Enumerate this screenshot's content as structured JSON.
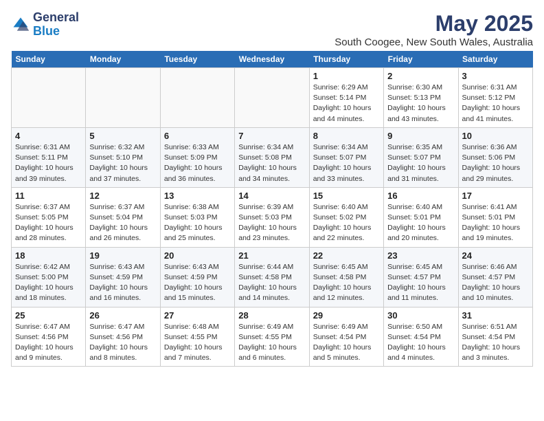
{
  "header": {
    "logo_general": "General",
    "logo_blue": "Blue",
    "month": "May 2025",
    "location": "South Coogee, New South Wales, Australia"
  },
  "weekdays": [
    "Sunday",
    "Monday",
    "Tuesday",
    "Wednesday",
    "Thursday",
    "Friday",
    "Saturday"
  ],
  "weeks": [
    [
      {
        "day": "",
        "text": ""
      },
      {
        "day": "",
        "text": ""
      },
      {
        "day": "",
        "text": ""
      },
      {
        "day": "",
        "text": ""
      },
      {
        "day": "1",
        "text": "Sunrise: 6:29 AM\nSunset: 5:14 PM\nDaylight: 10 hours\nand 44 minutes."
      },
      {
        "day": "2",
        "text": "Sunrise: 6:30 AM\nSunset: 5:13 PM\nDaylight: 10 hours\nand 43 minutes."
      },
      {
        "day": "3",
        "text": "Sunrise: 6:31 AM\nSunset: 5:12 PM\nDaylight: 10 hours\nand 41 minutes."
      }
    ],
    [
      {
        "day": "4",
        "text": "Sunrise: 6:31 AM\nSunset: 5:11 PM\nDaylight: 10 hours\nand 39 minutes."
      },
      {
        "day": "5",
        "text": "Sunrise: 6:32 AM\nSunset: 5:10 PM\nDaylight: 10 hours\nand 37 minutes."
      },
      {
        "day": "6",
        "text": "Sunrise: 6:33 AM\nSunset: 5:09 PM\nDaylight: 10 hours\nand 36 minutes."
      },
      {
        "day": "7",
        "text": "Sunrise: 6:34 AM\nSunset: 5:08 PM\nDaylight: 10 hours\nand 34 minutes."
      },
      {
        "day": "8",
        "text": "Sunrise: 6:34 AM\nSunset: 5:07 PM\nDaylight: 10 hours\nand 33 minutes."
      },
      {
        "day": "9",
        "text": "Sunrise: 6:35 AM\nSunset: 5:07 PM\nDaylight: 10 hours\nand 31 minutes."
      },
      {
        "day": "10",
        "text": "Sunrise: 6:36 AM\nSunset: 5:06 PM\nDaylight: 10 hours\nand 29 minutes."
      }
    ],
    [
      {
        "day": "11",
        "text": "Sunrise: 6:37 AM\nSunset: 5:05 PM\nDaylight: 10 hours\nand 28 minutes."
      },
      {
        "day": "12",
        "text": "Sunrise: 6:37 AM\nSunset: 5:04 PM\nDaylight: 10 hours\nand 26 minutes."
      },
      {
        "day": "13",
        "text": "Sunrise: 6:38 AM\nSunset: 5:03 PM\nDaylight: 10 hours\nand 25 minutes."
      },
      {
        "day": "14",
        "text": "Sunrise: 6:39 AM\nSunset: 5:03 PM\nDaylight: 10 hours\nand 23 minutes."
      },
      {
        "day": "15",
        "text": "Sunrise: 6:40 AM\nSunset: 5:02 PM\nDaylight: 10 hours\nand 22 minutes."
      },
      {
        "day": "16",
        "text": "Sunrise: 6:40 AM\nSunset: 5:01 PM\nDaylight: 10 hours\nand 20 minutes."
      },
      {
        "day": "17",
        "text": "Sunrise: 6:41 AM\nSunset: 5:01 PM\nDaylight: 10 hours\nand 19 minutes."
      }
    ],
    [
      {
        "day": "18",
        "text": "Sunrise: 6:42 AM\nSunset: 5:00 PM\nDaylight: 10 hours\nand 18 minutes."
      },
      {
        "day": "19",
        "text": "Sunrise: 6:43 AM\nSunset: 4:59 PM\nDaylight: 10 hours\nand 16 minutes."
      },
      {
        "day": "20",
        "text": "Sunrise: 6:43 AM\nSunset: 4:59 PM\nDaylight: 10 hours\nand 15 minutes."
      },
      {
        "day": "21",
        "text": "Sunrise: 6:44 AM\nSunset: 4:58 PM\nDaylight: 10 hours\nand 14 minutes."
      },
      {
        "day": "22",
        "text": "Sunrise: 6:45 AM\nSunset: 4:58 PM\nDaylight: 10 hours\nand 12 minutes."
      },
      {
        "day": "23",
        "text": "Sunrise: 6:45 AM\nSunset: 4:57 PM\nDaylight: 10 hours\nand 11 minutes."
      },
      {
        "day": "24",
        "text": "Sunrise: 6:46 AM\nSunset: 4:57 PM\nDaylight: 10 hours\nand 10 minutes."
      }
    ],
    [
      {
        "day": "25",
        "text": "Sunrise: 6:47 AM\nSunset: 4:56 PM\nDaylight: 10 hours\nand 9 minutes."
      },
      {
        "day": "26",
        "text": "Sunrise: 6:47 AM\nSunset: 4:56 PM\nDaylight: 10 hours\nand 8 minutes."
      },
      {
        "day": "27",
        "text": "Sunrise: 6:48 AM\nSunset: 4:55 PM\nDaylight: 10 hours\nand 7 minutes."
      },
      {
        "day": "28",
        "text": "Sunrise: 6:49 AM\nSunset: 4:55 PM\nDaylight: 10 hours\nand 6 minutes."
      },
      {
        "day": "29",
        "text": "Sunrise: 6:49 AM\nSunset: 4:54 PM\nDaylight: 10 hours\nand 5 minutes."
      },
      {
        "day": "30",
        "text": "Sunrise: 6:50 AM\nSunset: 4:54 PM\nDaylight: 10 hours\nand 4 minutes."
      },
      {
        "day": "31",
        "text": "Sunrise: 6:51 AM\nSunset: 4:54 PM\nDaylight: 10 hours\nand 3 minutes."
      }
    ]
  ]
}
